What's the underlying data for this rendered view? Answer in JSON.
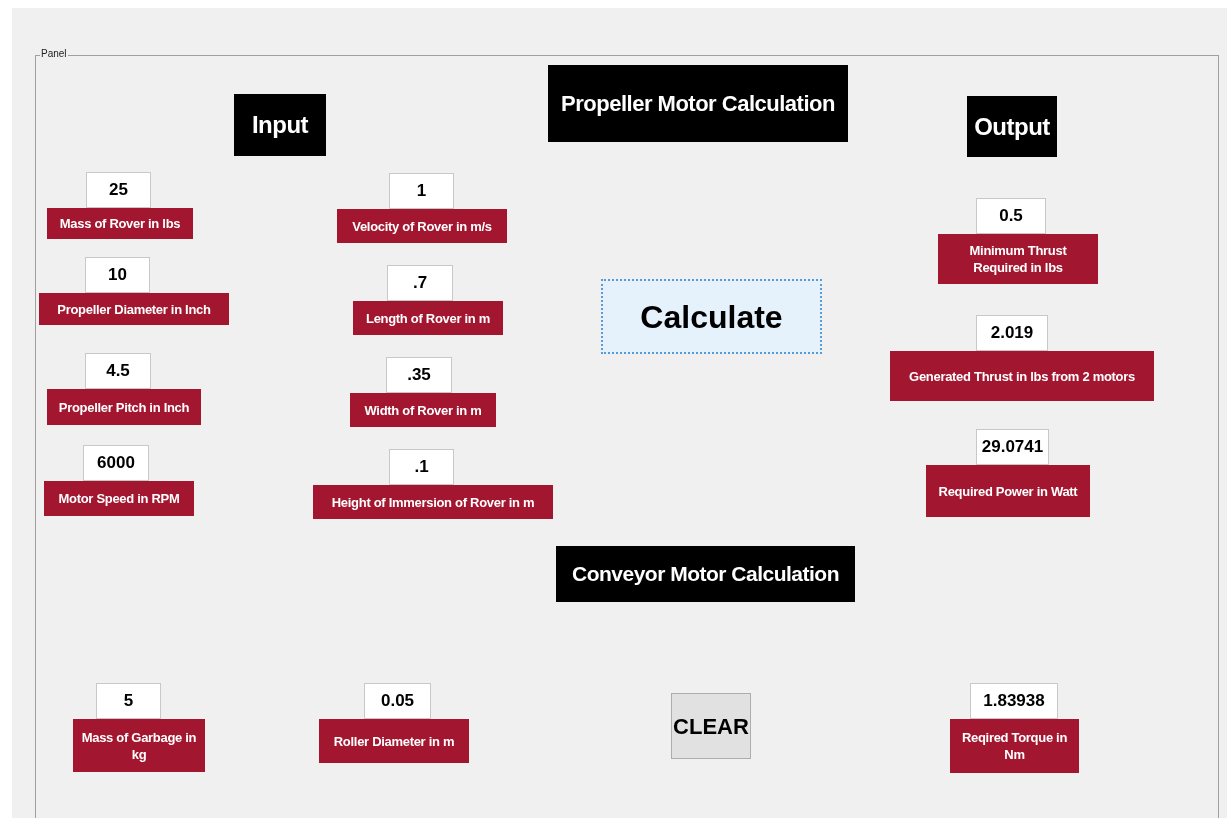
{
  "panel": {
    "title": "Panel",
    "headings": [
      "Input",
      "Propeller Motor Calculation",
      "Output",
      "Conveyor  Motor Calculation"
    ],
    "propeller_inputs": [
      {
        "value": "25",
        "label": "Mass of Rover in lbs"
      },
      {
        "value": "10",
        "label": "Propeller Diameter in Inch"
      },
      {
        "value": "4.5",
        "label": "Propeller Pitch in Inch"
      },
      {
        "value": "6000",
        "label": "Motor Speed in RPM"
      },
      {
        "value": "1",
        "label": "Velocity of Rover in m/s"
      },
      {
        "value": ".7",
        "label": "Length of Rover in m"
      },
      {
        "value": ".35",
        "label": "Width of Rover in m"
      },
      {
        "value": ".1",
        "label": "Height of Immersion of Rover in m"
      }
    ],
    "outputs": [
      {
        "value": "0.5",
        "label": "Minimum Thrust Required in lbs"
      },
      {
        "value": "2.019",
        "label": "Generated Thrust in lbs from 2 motors"
      },
      {
        "value": "29.0741",
        "label": "Required Power in Watt"
      }
    ],
    "conveyor_inputs": [
      {
        "value": "5",
        "label": "Mass of Garbage in kg"
      },
      {
        "value": "0.05",
        "label": "Roller Diameter in m"
      }
    ],
    "conveyor_output": {
      "value": "1.83938",
      "label": "Reqired Torque in Nm"
    },
    "buttons": [
      {
        "label": "Calculate",
        "focused": true
      },
      {
        "label": "CLEAR",
        "focused": false
      }
    ]
  }
}
